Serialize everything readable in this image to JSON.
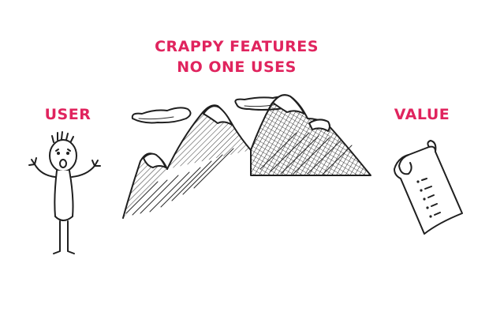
{
  "title": {
    "line1": "CRAPPY FEATURES",
    "line2": "NO ONE USES"
  },
  "left_label": "USER",
  "right_label": "VALUE",
  "accent_color": "#e0245e",
  "icons": [
    "sad-user-stick-figure-icon",
    "mountains-icon",
    "clouds-icon",
    "document-scroll-icon"
  ]
}
